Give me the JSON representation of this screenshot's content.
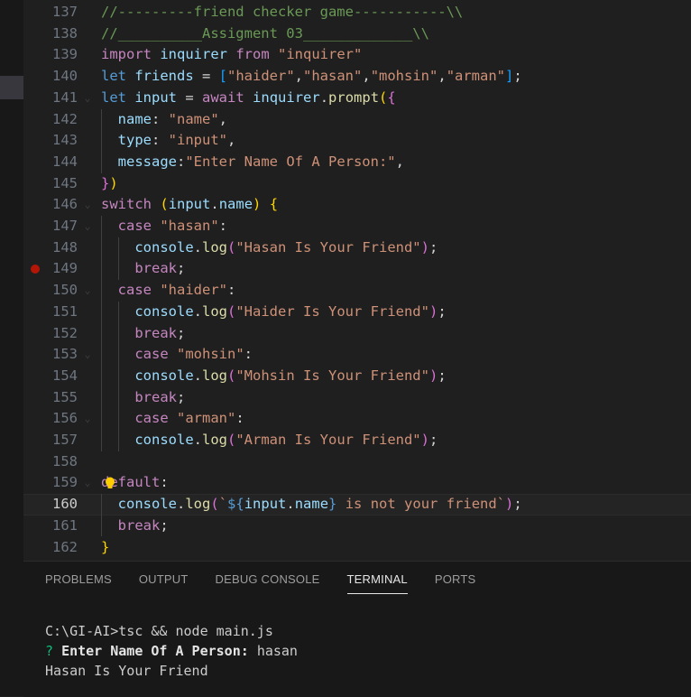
{
  "editor": {
    "lines": [
      {
        "n": "137",
        "tokens": [
          [
            "c",
            "//---------friend checker game-----------\\\\"
          ]
        ]
      },
      {
        "n": "138",
        "tokens": [
          [
            "c",
            "//__________Assigment 03_____________\\\\"
          ]
        ]
      },
      {
        "n": "139",
        "tokens": [
          [
            "k",
            "import"
          ],
          [
            "p",
            " "
          ],
          [
            "v",
            "inquirer"
          ],
          [
            "p",
            " "
          ],
          [
            "k",
            "from"
          ],
          [
            "p",
            " "
          ],
          [
            "s",
            "\"inquirer\""
          ]
        ]
      },
      {
        "n": "140",
        "tokens": [
          [
            "d",
            "let"
          ],
          [
            "p",
            " "
          ],
          [
            "v",
            "friends"
          ],
          [
            "p",
            " = "
          ],
          [
            "b3",
            "["
          ],
          [
            "s",
            "\"haider\""
          ],
          [
            "p",
            ","
          ],
          [
            "s",
            "\"hasan\""
          ],
          [
            "p",
            ","
          ],
          [
            "s",
            "\"mohsin\""
          ],
          [
            "p",
            ","
          ],
          [
            "s",
            "\"arman\""
          ],
          [
            "b3",
            "]"
          ],
          [
            "p",
            ";"
          ]
        ]
      },
      {
        "n": "141",
        "tokens": [
          [
            "d",
            "let"
          ],
          [
            "p",
            " "
          ],
          [
            "v",
            "input"
          ],
          [
            "p",
            " = "
          ],
          [
            "k",
            "await"
          ],
          [
            "p",
            " "
          ],
          [
            "v",
            "inquirer"
          ],
          [
            "p",
            "."
          ],
          [
            "f",
            "prompt"
          ],
          [
            "b1",
            "("
          ],
          [
            "b2",
            "{"
          ]
        ]
      },
      {
        "n": "142",
        "tokens": [
          [
            "p",
            "  "
          ],
          [
            "v",
            "name"
          ],
          [
            "p",
            ": "
          ],
          [
            "s",
            "\"name\""
          ],
          [
            "p",
            ","
          ]
        ]
      },
      {
        "n": "143",
        "tokens": [
          [
            "p",
            "  "
          ],
          [
            "v",
            "type"
          ],
          [
            "p",
            ": "
          ],
          [
            "s",
            "\"input\""
          ],
          [
            "p",
            ","
          ]
        ]
      },
      {
        "n": "144",
        "tokens": [
          [
            "p",
            "  "
          ],
          [
            "v",
            "message"
          ],
          [
            "p",
            ":"
          ],
          [
            "s",
            "\"Enter Name Of A Person:\""
          ],
          [
            "p",
            ","
          ]
        ]
      },
      {
        "n": "145",
        "tokens": [
          [
            "b2",
            "}"
          ],
          [
            "b1",
            ")"
          ]
        ]
      },
      {
        "n": "146",
        "tokens": [
          [
            "k",
            "switch"
          ],
          [
            "p",
            " "
          ],
          [
            "b1",
            "("
          ],
          [
            "v",
            "input"
          ],
          [
            "p",
            "."
          ],
          [
            "v",
            "name"
          ],
          [
            "b1",
            ")"
          ],
          [
            "p",
            " "
          ],
          [
            "b1",
            "{"
          ]
        ]
      },
      {
        "n": "147",
        "tokens": [
          [
            "p",
            "  "
          ],
          [
            "k",
            "case"
          ],
          [
            "p",
            " "
          ],
          [
            "s",
            "\"hasan\""
          ],
          [
            "p",
            ":"
          ]
        ]
      },
      {
        "n": "148",
        "tokens": [
          [
            "p",
            "    "
          ],
          [
            "v",
            "console"
          ],
          [
            "p",
            "."
          ],
          [
            "f",
            "log"
          ],
          [
            "b2",
            "("
          ],
          [
            "s",
            "\"Hasan Is Your Friend\""
          ],
          [
            "b2",
            ")"
          ],
          [
            "p",
            ";"
          ]
        ]
      },
      {
        "n": "149",
        "tokens": [
          [
            "p",
            "    "
          ],
          [
            "k",
            "break"
          ],
          [
            "p",
            ";"
          ]
        ]
      },
      {
        "n": "150",
        "tokens": [
          [
            "p",
            "  "
          ],
          [
            "k",
            "case"
          ],
          [
            "p",
            " "
          ],
          [
            "s",
            "\"haider\""
          ],
          [
            "p",
            ":"
          ]
        ]
      },
      {
        "n": "151",
        "tokens": [
          [
            "p",
            "    "
          ],
          [
            "v",
            "console"
          ],
          [
            "p",
            "."
          ],
          [
            "f",
            "log"
          ],
          [
            "b2",
            "("
          ],
          [
            "s",
            "\"Haider Is Your Friend\""
          ],
          [
            "b2",
            ")"
          ],
          [
            "p",
            ";"
          ]
        ]
      },
      {
        "n": "152",
        "tokens": [
          [
            "p",
            "    "
          ],
          [
            "k",
            "break"
          ],
          [
            "p",
            ";"
          ]
        ]
      },
      {
        "n": "153",
        "tokens": [
          [
            "p",
            "    "
          ],
          [
            "k",
            "case"
          ],
          [
            "p",
            " "
          ],
          [
            "s",
            "\"mohsin\""
          ],
          [
            "p",
            ":"
          ]
        ]
      },
      {
        "n": "154",
        "tokens": [
          [
            "p",
            "    "
          ],
          [
            "v",
            "console"
          ],
          [
            "p",
            "."
          ],
          [
            "f",
            "log"
          ],
          [
            "b2",
            "("
          ],
          [
            "s",
            "\"Mohsin Is Your Friend\""
          ],
          [
            "b2",
            ")"
          ],
          [
            "p",
            ";"
          ]
        ]
      },
      {
        "n": "155",
        "tokens": [
          [
            "p",
            "    "
          ],
          [
            "k",
            "break"
          ],
          [
            "p",
            ";"
          ]
        ]
      },
      {
        "n": "156",
        "tokens": [
          [
            "p",
            "    "
          ],
          [
            "k",
            "case"
          ],
          [
            "p",
            " "
          ],
          [
            "s",
            "\"arman\""
          ],
          [
            "p",
            ":"
          ]
        ]
      },
      {
        "n": "157",
        "tokens": [
          [
            "p",
            "    "
          ],
          [
            "v",
            "console"
          ],
          [
            "p",
            "."
          ],
          [
            "f",
            "log"
          ],
          [
            "b2",
            "("
          ],
          [
            "s",
            "\"Arman Is Your Friend\""
          ],
          [
            "b2",
            ")"
          ],
          [
            "p",
            ";"
          ]
        ]
      },
      {
        "n": "158",
        "tokens": []
      },
      {
        "n": "159",
        "tokens": [
          [
            "k",
            "default"
          ],
          [
            "p",
            ":"
          ]
        ]
      },
      {
        "n": "160",
        "tokens": [
          [
            "p",
            "  "
          ],
          [
            "v",
            "console"
          ],
          [
            "p",
            "."
          ],
          [
            "f",
            "log"
          ],
          [
            "b2",
            "("
          ],
          [
            "s",
            "`"
          ],
          [
            "d",
            "${"
          ],
          [
            "v",
            "input"
          ],
          [
            "p",
            "."
          ],
          [
            "v",
            "name"
          ],
          [
            "d",
            "}"
          ],
          [
            "s",
            " is not your friend`"
          ],
          [
            "b2",
            ")"
          ],
          [
            "p",
            ";"
          ]
        ]
      },
      {
        "n": "161",
        "tokens": [
          [
            "p",
            "  "
          ],
          [
            "k",
            "break"
          ],
          [
            "p",
            ";"
          ]
        ]
      },
      {
        "n": "162",
        "tokens": [
          [
            "b1",
            "}"
          ]
        ]
      }
    ],
    "current_line": "160",
    "breakpoint_line": "149"
  },
  "panel": {
    "tabs": [
      "PROBLEMS",
      "OUTPUT",
      "DEBUG CONSOLE",
      "TERMINAL",
      "PORTS"
    ],
    "active_tab": "TERMINAL",
    "terminal": {
      "command": "C:\\GI-AI>tsc && node main.js",
      "prompt_mark": "?",
      "prompt_label": "Enter Name Of A Person:",
      "prompt_answer": "hasan",
      "output": "Hasan Is Your Friend"
    }
  },
  "colors": {
    "comment": "#6a9955",
    "keyword": "#c586c0",
    "declaration": "#569cd6",
    "variable": "#9cdcfe",
    "string": "#ce9178",
    "function": "#dcdcaa"
  }
}
